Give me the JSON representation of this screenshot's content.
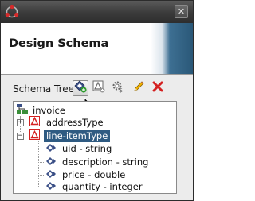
{
  "window": {
    "close_glyph": "✕"
  },
  "header": {
    "title": "Design Schema"
  },
  "toolbar": {
    "label": "Schema Tree",
    "buttons": [
      {
        "name": "add-element-button",
        "icon": "diamond-plus-icon"
      },
      {
        "name": "add-type-button",
        "icon": "triangle-type-icon"
      },
      {
        "name": "settings-button",
        "icon": "gear-dollar-icon"
      },
      {
        "name": "edit-button",
        "icon": "pencil-icon"
      },
      {
        "name": "delete-button",
        "icon": "red-x-icon"
      }
    ]
  },
  "tree": {
    "root": {
      "label": "invoice",
      "icon": "hierarchy-icon"
    },
    "types": [
      {
        "label": "addressType",
        "expanded": false,
        "icon": "type-icon"
      },
      {
        "label": "line-itemType",
        "expanded": true,
        "selected": true,
        "icon": "type-icon",
        "children": [
          {
            "label": "uid - string",
            "icon": "element-icon"
          },
          {
            "label": "description - string",
            "icon": "element-icon"
          },
          {
            "label": "price - double",
            "icon": "element-icon"
          },
          {
            "label": "quantity - integer",
            "icon": "element-icon"
          }
        ]
      }
    ]
  },
  "colors": {
    "selection": "#2f5b82",
    "delete_red": "#d42020",
    "element_icon": "#3a4f86"
  }
}
